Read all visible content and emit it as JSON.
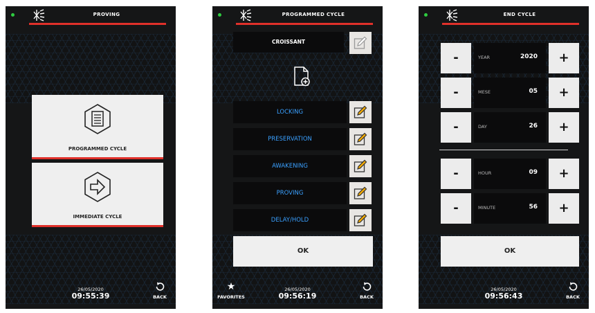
{
  "colors": {
    "accent": "#e0302a",
    "phase_text": "#3aa0ff",
    "status_led": "#2ecc40"
  },
  "screens": [
    {
      "title": "PROVING",
      "cards": [
        {
          "label": "PROGRAMMED CYCLE",
          "icon": "checklist-icon"
        },
        {
          "label": "IMMEDIATE CYCLE",
          "icon": "arrow-right-icon"
        }
      ],
      "date": "26/05/2020",
      "time": "09:55:39",
      "back_label": "BACK"
    },
    {
      "title": "PROGRAMMED CYCLE",
      "recipe_name": "CROISSANT",
      "phases": [
        "LOCKING",
        "PRESERVATION",
        "AWAKENING",
        "PROVING",
        "DELAY/HOLD"
      ],
      "ok_label": "OK",
      "favorites_label": "FAVORITES",
      "date": "26/05/2020",
      "time": "09:56:19",
      "back_label": "BACK"
    },
    {
      "title": "END CYCLE",
      "fields": [
        {
          "label": "YEAR",
          "value": "2020"
        },
        {
          "label": "MESE",
          "value": "05"
        },
        {
          "label": "DAY",
          "value": "26"
        },
        {
          "label": "HOUR",
          "value": "09"
        },
        {
          "label": "MINUTE",
          "value": "56"
        }
      ],
      "minus_label": "-",
      "plus_label": "+",
      "ok_label": "OK",
      "date": "26/05/2020",
      "time": "09:56:43",
      "back_label": "BACK"
    }
  ]
}
